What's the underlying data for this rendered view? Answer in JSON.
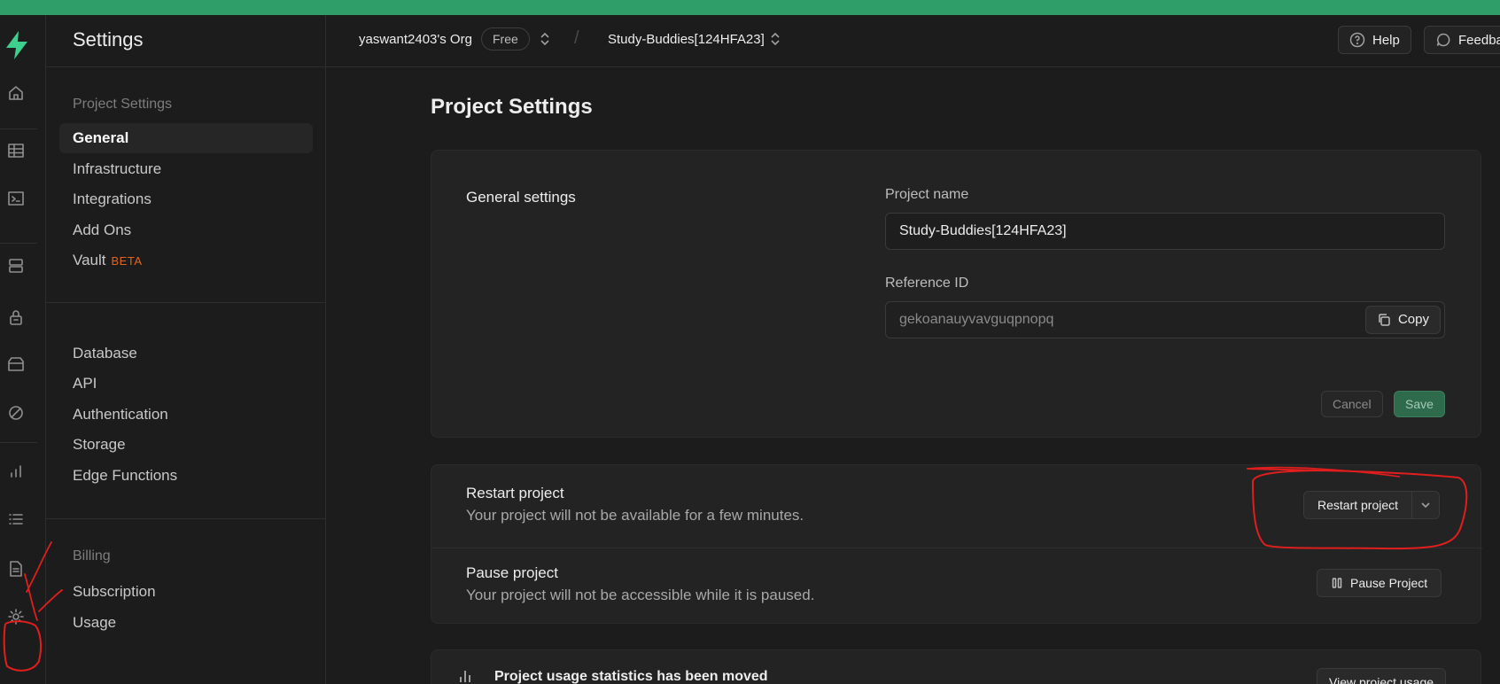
{
  "colors": {
    "accent": "#3ecf8e",
    "topbar": "#2f9e69",
    "beta": "#e3651d",
    "annotation": "#e01e1e"
  },
  "rail": {
    "icons": [
      "logo-icon",
      "home-icon",
      "table-editor-icon",
      "sql-editor-icon",
      "database-icon",
      "auth-lock-icon",
      "storage-icon",
      "realtime-icon",
      "reports-icon",
      "logs-icon",
      "docs-icon",
      "settings-gear-icon"
    ]
  },
  "sidebar": {
    "title": "Settings",
    "project_settings_label": "Project Settings",
    "project_items": [
      "General",
      "Infrastructure",
      "Integrations",
      "Add Ons",
      "Vault"
    ],
    "vault_badge": "BETA",
    "config_items": [
      "Database",
      "API",
      "Authentication",
      "Storage",
      "Edge Functions"
    ],
    "billing_label": "Billing",
    "billing_items": [
      "Subscription",
      "Usage"
    ]
  },
  "header": {
    "org_name": "yaswant2403's Org",
    "plan": "Free",
    "project_name": "Study-Buddies[124HFA23]",
    "help_label": "Help",
    "feedback_label": "Feedba"
  },
  "main": {
    "title": "Project Settings",
    "general": {
      "section_label": "General settings",
      "project_name_label": "Project name",
      "project_name_value": "Study-Buddies[124HFA23]",
      "reference_id_label": "Reference ID",
      "reference_id_value": "gekoanauyvavguqpnopq",
      "copy_label": "Copy",
      "cancel_label": "Cancel",
      "save_label": "Save"
    },
    "restart": {
      "title": "Restart project",
      "desc": "Your project will not be available for a few minutes.",
      "button_label": "Restart project"
    },
    "pause": {
      "title": "Pause project",
      "desc": "Your project will not be accessible while it is paused.",
      "button_label": "Pause Project"
    },
    "usage": {
      "text": "Project usage statistics has been moved",
      "button_label": "View project usage"
    }
  }
}
